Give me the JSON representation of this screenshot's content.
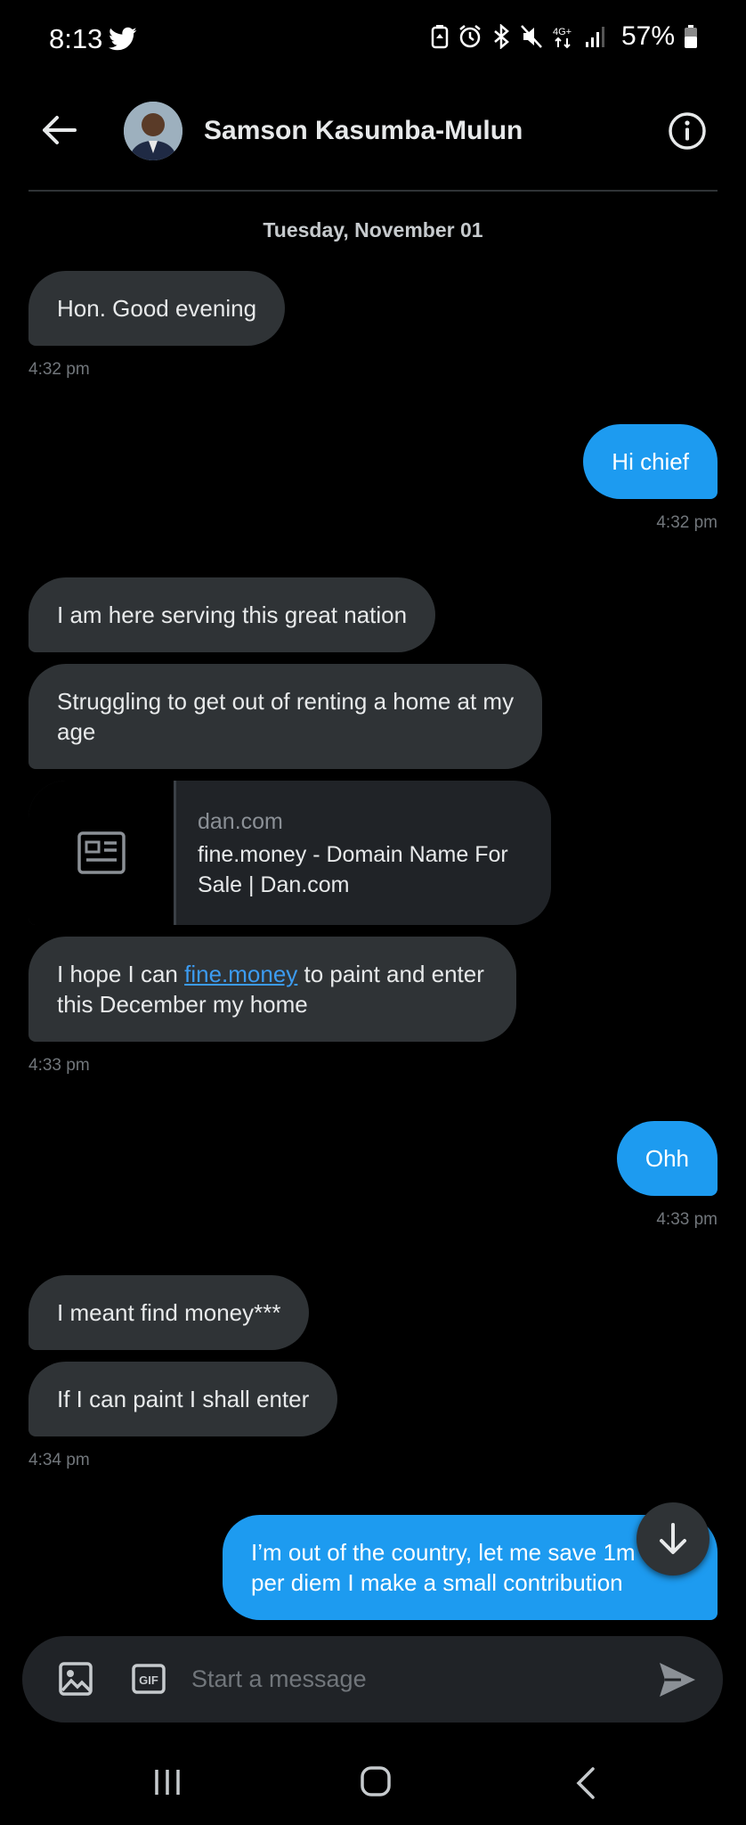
{
  "status_bar": {
    "time": "8:13",
    "battery": "57%",
    "network": "4G+",
    "icons": [
      "twitter-icon",
      "battery-saver-icon",
      "alarm-icon",
      "bluetooth-icon",
      "mute-icon",
      "network-icon",
      "signal-icon",
      "battery-icon"
    ]
  },
  "header": {
    "contact_name": "Samson Kasumba-Mulun",
    "back_icon": "arrow-left-icon",
    "info_icon": "info-icon"
  },
  "conversation": {
    "date": "Tuesday, November 01",
    "messages": [
      {
        "direction": "incoming",
        "text": "Hon. Good evening",
        "time": "4:32 pm"
      },
      {
        "direction": "outgoing",
        "text": "Hi chief",
        "time": "4:32 pm"
      },
      {
        "direction": "incoming",
        "text": "I am here serving this great nation"
      },
      {
        "direction": "incoming",
        "text": "Struggling to get out of renting a home at my age"
      },
      {
        "direction": "incoming",
        "type": "link_card",
        "domain": "dan.com",
        "title": "fine.money - Domain Name For Sale | Dan.com"
      },
      {
        "direction": "incoming",
        "text_before": "I hope I can ",
        "link": "fine.money",
        "text_after": " to paint and enter this December my home",
        "time": "4:33 pm"
      },
      {
        "direction": "outgoing",
        "text": "Ohh",
        "time": "4:33 pm"
      },
      {
        "direction": "incoming",
        "text": "I meant find money***"
      },
      {
        "direction": "incoming",
        "text": "If I can paint I shall enter",
        "time": "4:34 pm"
      },
      {
        "direction": "outgoing",
        "text": "I’m out of the country, let me save 1m from per diem I make a small contribution"
      }
    ]
  },
  "composer": {
    "placeholder": "Start a message",
    "value": "",
    "gif_label": "GIF"
  },
  "colors": {
    "background": "#000000",
    "incoming_bubble": "#2f3336",
    "outgoing_bubble": "#1d9bf0",
    "link": "#3c9bf0",
    "timestamp": "#71767b"
  }
}
